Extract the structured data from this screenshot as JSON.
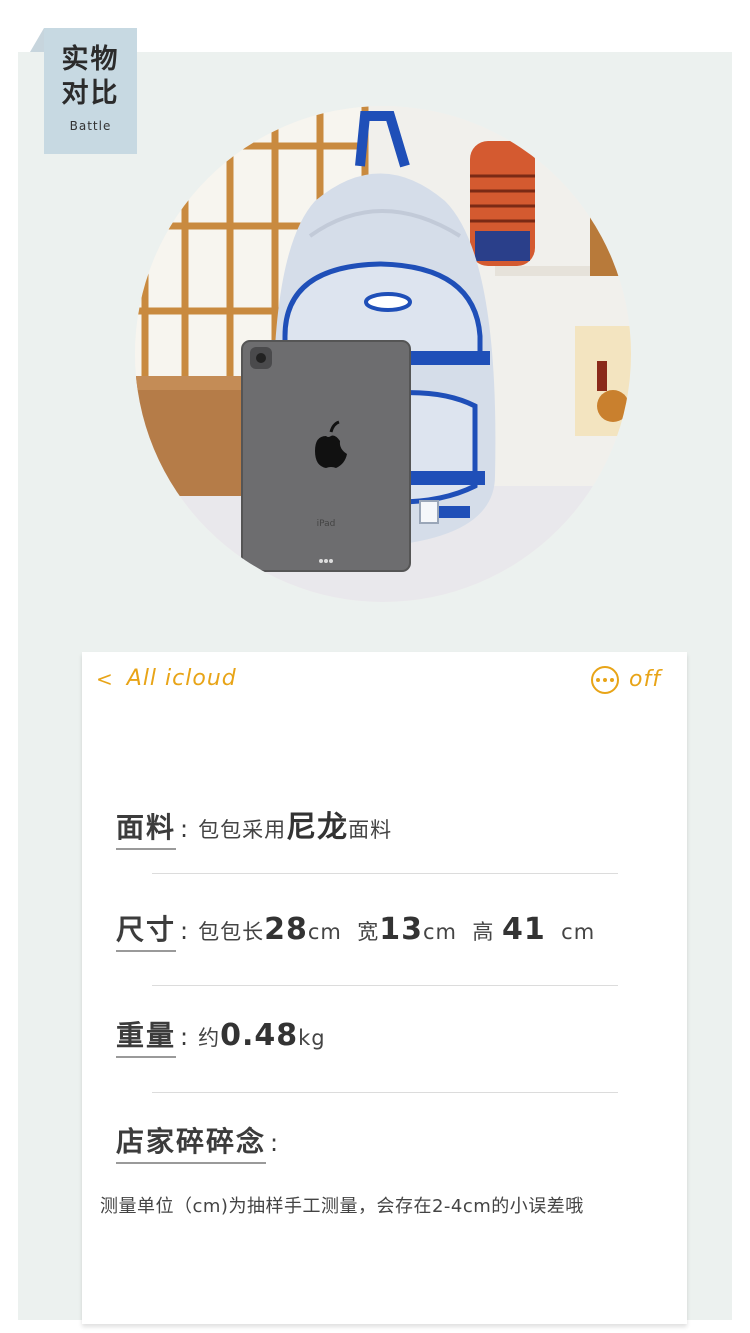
{
  "tag": {
    "title_line1": "实物",
    "title_line2": "对比",
    "subtitle": "Battle"
  },
  "photo": {
    "tablet_brand_text": "iPad"
  },
  "card": {
    "back_label": "All icloud",
    "back_chevron": "<",
    "more_icon": "more-horizontal-circle-icon",
    "off_label": "off"
  },
  "specs": {
    "material": {
      "label": "面料",
      "colon": ":",
      "prefix": "包包采用",
      "highlight": "尼龙",
      "suffix": "面料"
    },
    "size": {
      "label": "尺寸",
      "colon": ":",
      "length_prefix": "包包长",
      "length": "28",
      "length_unit": "cm",
      "width_prefix": "宽",
      "width": "13",
      "width_unit": "cm",
      "height_prefix": "高",
      "height": "41",
      "height_unit": "cm"
    },
    "weight": {
      "label": "重量",
      "colon": ":",
      "prefix": "约",
      "value": "0.48",
      "unit": "kg"
    },
    "note": {
      "label": "店家碎碎念",
      "colon": ":",
      "text": "测量单位（cm)为抽样手工测量，会存在2-4cm的小误差哦"
    }
  },
  "colors": {
    "accent": "#e8a417",
    "tag_bg": "#c7d9e2",
    "frame_bg": "#ecf1ef",
    "backpack_trim": "#1f4fb8"
  }
}
